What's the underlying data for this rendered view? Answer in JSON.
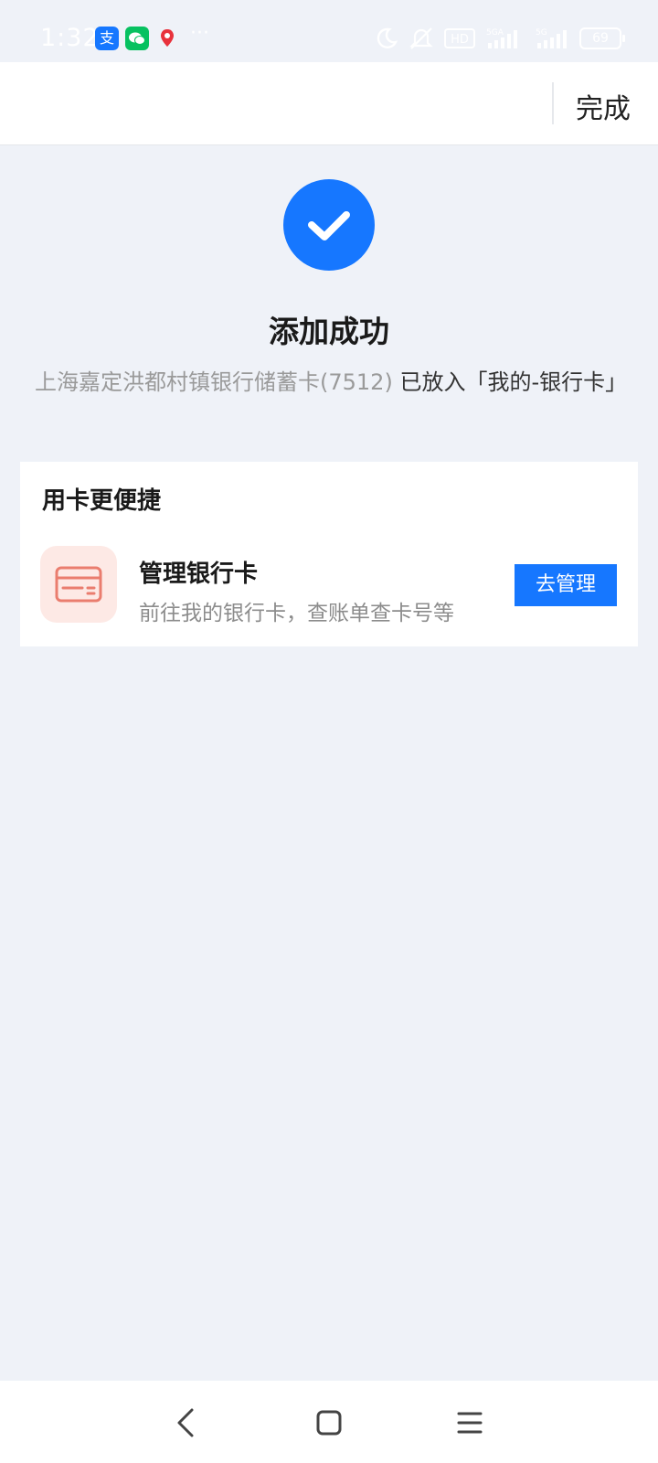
{
  "status_bar": {
    "time": "1:32",
    "more": "···",
    "battery": "69",
    "app_icons": [
      {
        "name": "alipay-icon",
        "glyph": "支",
        "color": "#1677ff"
      },
      {
        "name": "wechat-icon",
        "color": "#07c160"
      },
      {
        "name": "map-pin-icon",
        "color": "#e8323c"
      }
    ]
  },
  "header": {
    "done_label": "完成"
  },
  "result": {
    "title": "添加成功",
    "card_name": "上海嘉定洪都村镇银行储蓄卡(7512)",
    "placed_text": "已放入「我的-银行卡」"
  },
  "section": {
    "title": "用卡更便捷",
    "feature": {
      "title": "管理银行卡",
      "description": "前往我的银行卡，查账单查卡号等",
      "button_label": "去管理"
    }
  },
  "colors": {
    "accent": "#1677ff",
    "background": "#eff2f8",
    "icon_tint": "#fde9e5"
  }
}
